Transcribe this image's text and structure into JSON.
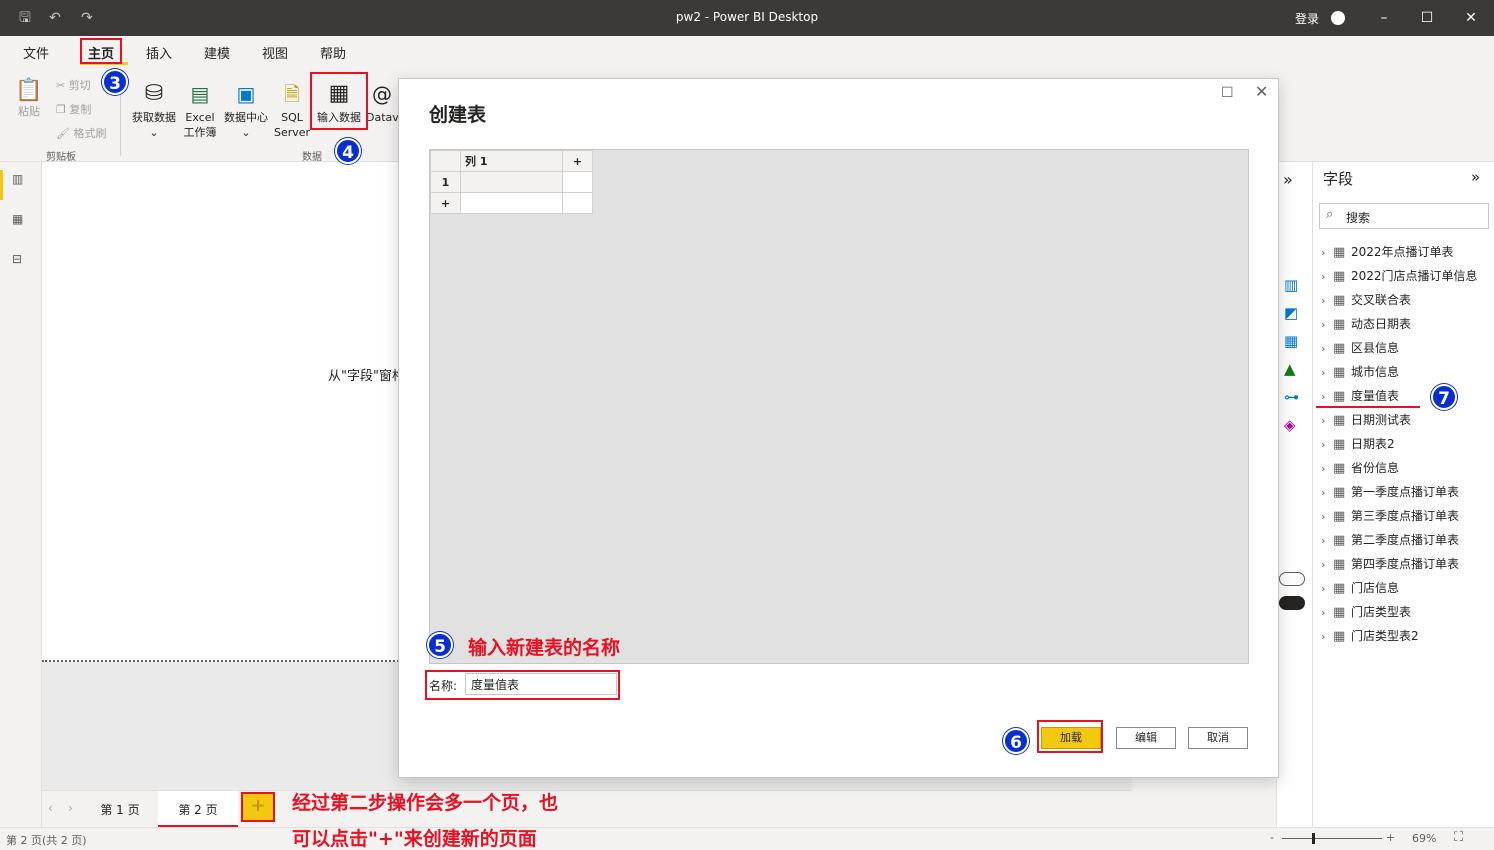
{
  "window": {
    "title": "pw2 - Power BI Desktop",
    "login": "登录"
  },
  "ribbon": {
    "tabs": [
      "文件",
      "主页",
      "插入",
      "建模",
      "视图",
      "帮助"
    ],
    "active_tab": "主页",
    "clipboard": {
      "paste": "粘贴",
      "cut": "剪切",
      "copy": "复制",
      "format_painter": "格式刷",
      "group_label": "剪贴板"
    },
    "data": {
      "get_data": "获取数据",
      "excel": "Excel",
      "excel_sub": "工作簿",
      "data_hub": "数据中心",
      "sql": "SQL",
      "sql_sub": "Server",
      "enter_data": "输入数据",
      "dataverse": "Datave",
      "group_label": "数据"
    }
  },
  "canvas": {
    "hint": "从\"字段\"窗格"
  },
  "fields_pane": {
    "title": "字段",
    "search_placeholder": "搜索",
    "tables": [
      "2022年点播订单表",
      "2022门店点播订单信息",
      "交叉联合表",
      "动态日期表",
      "区县信息",
      "城市信息",
      "度量值表",
      "日期测试表",
      "日期表2",
      "省份信息",
      "第一季度点播订单表",
      "第三季度点播订单表",
      "第二季度点播订单表",
      "第四季度点播订单表",
      "门店信息",
      "门店类型表",
      "门店类型表2"
    ]
  },
  "dialog": {
    "title": "创建表",
    "column_header": "列 1",
    "add_col": "+",
    "row_1": "1",
    "add_row": "+",
    "name_label": "名称:",
    "name_value": "度量值表",
    "load": "加载",
    "edit": "编辑",
    "cancel": "取消"
  },
  "page_tabs": {
    "page1": "第 1 页",
    "page2": "第 2 页",
    "add": "+"
  },
  "status": {
    "pages": "第 2 页(共 2 页)",
    "zoom": "69%"
  },
  "annotations": {
    "step3": "3",
    "step4": "4",
    "step5": "5",
    "step5_text": "输入新建表的名称",
    "step6": "6",
    "step7": "7",
    "note_line1": "经过第二步操作会多一个页，也",
    "note_line2": "可以点击\"+\"来创建新的页面"
  },
  "colors": {
    "accent": "#f2c811",
    "annotation_red": "#e81123",
    "annotation_blue": "#0a2fcf"
  }
}
